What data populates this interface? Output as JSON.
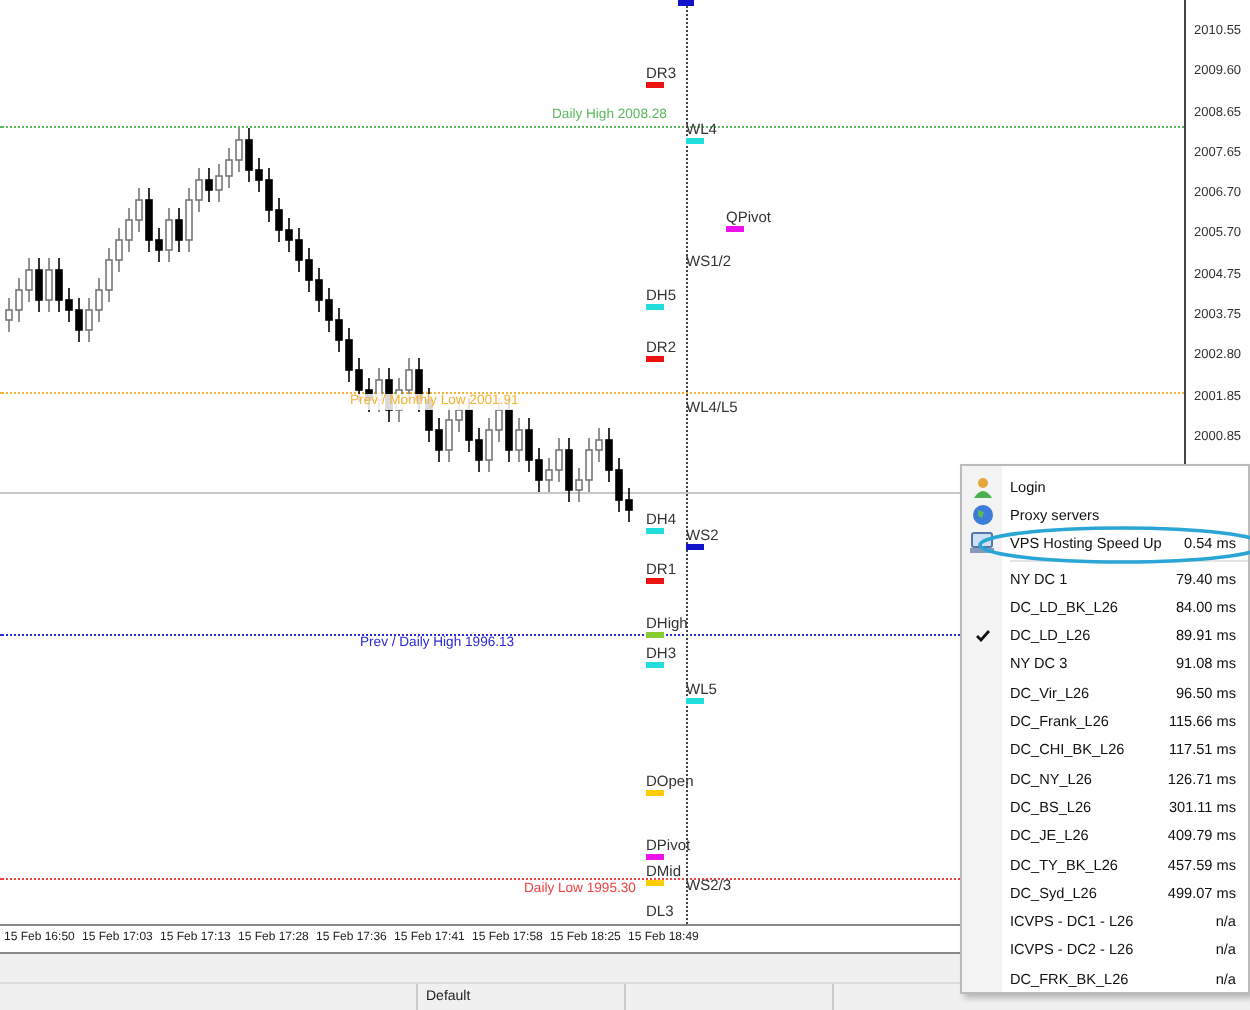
{
  "price_axis": [
    "2010.55",
    "2009.60",
    "2008.65",
    "2007.65",
    "2006.70",
    "2005.70",
    "2004.75",
    "2003.75",
    "2002.80",
    "2001.85",
    "2000.85"
  ],
  "time_axis": [
    "15 Feb 16:50",
    "15 Feb 17:03",
    "15 Feb 17:13",
    "15 Feb 17:28",
    "15 Feb 17:36",
    "15 Feb 17:41",
    "15 Feb 17:58",
    "15 Feb 18:25",
    "15 Feb 18:49"
  ],
  "lines": [
    {
      "label": "Daily High 2008.28",
      "color": "#5cb85c"
    },
    {
      "label": "Prev / Monthly Low 2001.91",
      "color": "#f5b335"
    },
    {
      "label": "Prev / Daily High 1996.13",
      "color": "#2a2ad8"
    },
    {
      "label": "Daily Low 1995.30",
      "color": "#f04040"
    }
  ],
  "levels": [
    {
      "label": "DR3",
      "color": "#ee1111"
    },
    {
      "label": "WL4",
      "color": "#22dddd"
    },
    {
      "label": "QPivot",
      "color": "#ee11ee"
    },
    {
      "label": "WS1/2"
    },
    {
      "label": "DH5",
      "color": "#22dddd"
    },
    {
      "label": "DR2",
      "color": "#ee1111"
    },
    {
      "label": "WL4/L5"
    },
    {
      "label": "DH4",
      "color": "#22dddd"
    },
    {
      "label": "WS2",
      "color": "#1111cc"
    },
    {
      "label": "DR1",
      "color": "#ee1111"
    },
    {
      "label": "DHigh",
      "color": "#88cc33"
    },
    {
      "label": "DH3",
      "color": "#22dddd"
    },
    {
      "label": "WL5",
      "color": "#22dddd"
    },
    {
      "label": "DOpen",
      "color": "#ffcc00"
    },
    {
      "label": "DPivot",
      "color": "#ee11ee"
    },
    {
      "label": "DMid",
      "color": "#ffcc00"
    },
    {
      "label": "WS2/3"
    },
    {
      "label": "DL3"
    }
  ],
  "menu": {
    "items": [
      {
        "kind": "action",
        "label": "Login"
      },
      {
        "kind": "action",
        "label": "Proxy servers"
      },
      {
        "kind": "action",
        "label": "VPS Hosting Speed Up",
        "value": "0.54 ms"
      },
      {
        "kind": "server",
        "label": "NY DC 1",
        "value": "79.40 ms",
        "checked": false
      },
      {
        "kind": "server",
        "label": "DC_LD_BK_L26",
        "value": "84.00 ms",
        "checked": false
      },
      {
        "kind": "server",
        "label": "DC_LD_L26",
        "value": "89.91 ms",
        "checked": true
      },
      {
        "kind": "server",
        "label": "NY DC 3",
        "value": "91.08 ms",
        "checked": false
      },
      {
        "kind": "server",
        "label": "DC_Vir_L26",
        "value": "96.50 ms",
        "checked": false
      },
      {
        "kind": "server",
        "label": "DC_Frank_L26",
        "value": "115.66 ms",
        "checked": false
      },
      {
        "kind": "server",
        "label": "DC_CHI_BK_L26",
        "value": "117.51 ms",
        "checked": false
      },
      {
        "kind": "server",
        "label": "DC_NY_L26",
        "value": "126.71 ms",
        "checked": false
      },
      {
        "kind": "server",
        "label": "DC_BS_L26",
        "value": "301.11 ms",
        "checked": false
      },
      {
        "kind": "server",
        "label": "DC_JE_L26",
        "value": "409.79 ms",
        "checked": false
      },
      {
        "kind": "server",
        "label": "DC_TY_BK_L26",
        "value": "457.59 ms",
        "checked": false
      },
      {
        "kind": "server",
        "label": "DC_Syd_L26",
        "value": "499.07 ms",
        "checked": false
      },
      {
        "kind": "server",
        "label": "ICVPS - DC1 - L26",
        "value": "n/a",
        "checked": false
      },
      {
        "kind": "server",
        "label": "ICVPS - DC2 - L26",
        "value": "n/a",
        "checked": false
      },
      {
        "kind": "server",
        "label": "DC_FRK_BK_L26",
        "value": "n/a",
        "checked": false
      }
    ]
  },
  "status_bar": {
    "profile": "Default"
  }
}
